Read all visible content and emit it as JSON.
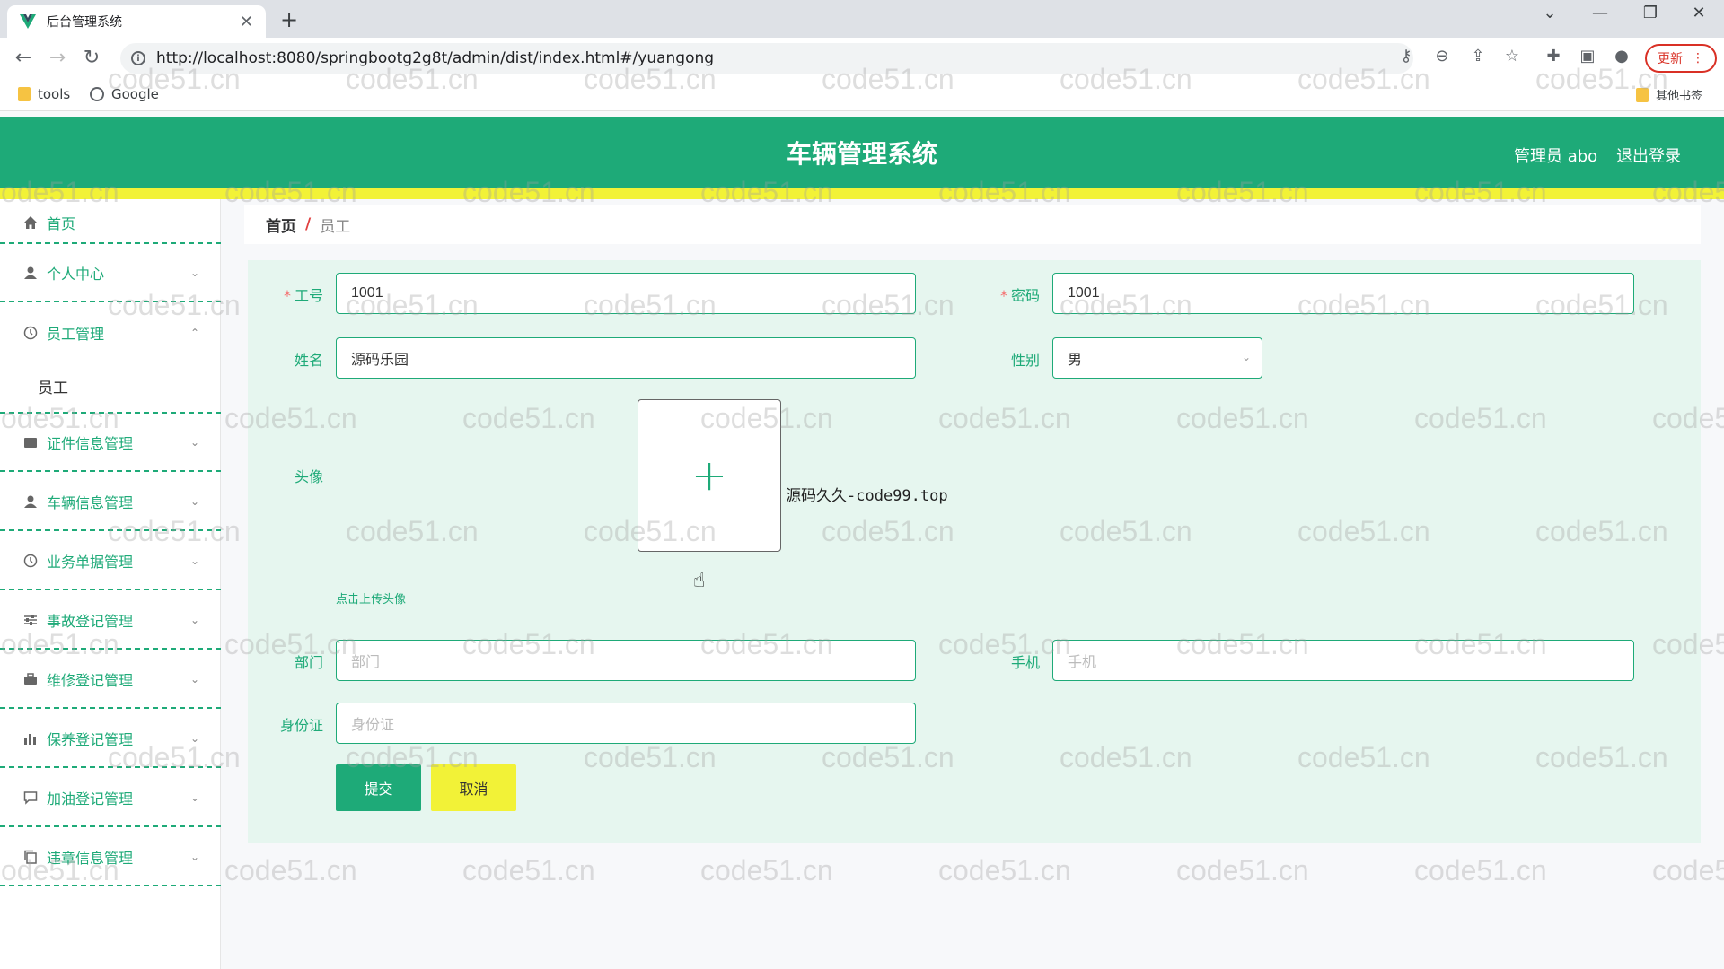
{
  "browser": {
    "tab_title": "后台管理系统",
    "url": "http://localhost:8080/springbootg2g8t/admin/dist/index.html#/yuangong",
    "update_label": "更新",
    "bookmarks": [
      {
        "label": "tools",
        "icon": "folder-icon"
      },
      {
        "label": "Google",
        "icon": "globe-icon"
      }
    ],
    "other_bookmarks": "其他书签"
  },
  "header": {
    "title": "车辆管理系统",
    "user": "管理员 abo",
    "logout": "退出登录"
  },
  "sidebar": {
    "items": [
      {
        "label": "首页",
        "icon": "home-icon",
        "arrow": ""
      },
      {
        "label": "个人中心",
        "icon": "user-icon",
        "arrow": "⌄"
      },
      {
        "label": "员工管理",
        "icon": "clock-icon",
        "arrow": "⌃"
      },
      {
        "label": "证件信息管理",
        "icon": "card-icon",
        "arrow": "⌄"
      },
      {
        "label": "车辆信息管理",
        "icon": "user-icon",
        "arrow": "⌄"
      },
      {
        "label": "业务单据管理",
        "icon": "clock-icon",
        "arrow": "⌄"
      },
      {
        "label": "事故登记管理",
        "icon": "sliders-icon",
        "arrow": "⌄"
      },
      {
        "label": "维修登记管理",
        "icon": "briefcase-icon",
        "arrow": "⌄"
      },
      {
        "label": "保养登记管理",
        "icon": "bar-chart-icon",
        "arrow": "⌄"
      },
      {
        "label": "加油登记管理",
        "icon": "chat-icon",
        "arrow": "⌄"
      },
      {
        "label": "违章信息管理",
        "icon": "copy-icon",
        "arrow": "⌄"
      }
    ],
    "submenu": "员工"
  },
  "breadcrumb": {
    "home": "首页",
    "separator": "/",
    "current": "员工"
  },
  "form": {
    "gonghao": {
      "label": "工号",
      "value": "1001"
    },
    "mima": {
      "label": "密码",
      "value": "1001"
    },
    "xingming": {
      "label": "姓名",
      "value": "源码乐园"
    },
    "xingbie": {
      "label": "性别",
      "value": "男"
    },
    "touxiang": {
      "label": "头像",
      "tip": "点击上传头像",
      "overlay": "源码久久-code99.top"
    },
    "bumen": {
      "label": "部门",
      "placeholder": "部门"
    },
    "shouji": {
      "label": "手机",
      "placeholder": "手机"
    },
    "shenfenzheng": {
      "label": "身份证",
      "placeholder": "身份证"
    },
    "submit": "提交",
    "cancel": "取消"
  },
  "watermark": "code51.cn",
  "colors": {
    "primary": "#1eaa78",
    "accent": "#f2f237"
  }
}
